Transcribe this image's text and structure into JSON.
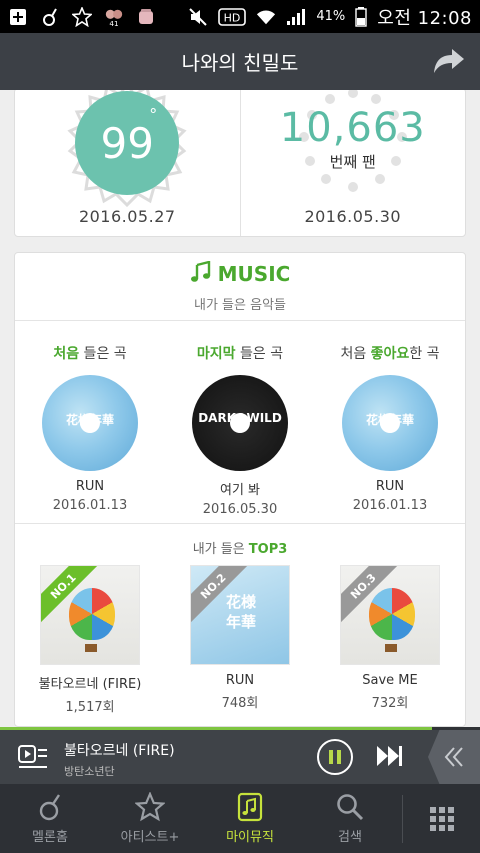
{
  "status_bar": {
    "battery": "41%",
    "time": "오전 12:08",
    "notification_count": "41"
  },
  "header": {
    "title": "나와의 친밀도",
    "share_icon": "share-arrow-icon"
  },
  "intimacy": {
    "temperature": {
      "value": "99",
      "unit": "°",
      "date": "2016.05.27"
    },
    "fan_rank": {
      "value": "10,663",
      "label": "번째 팬",
      "date": "2016.05.30"
    }
  },
  "music": {
    "title": "MUSIC",
    "subtitle": "내가 들은 음악들",
    "firsts": [
      {
        "label_highlight": "처음",
        "label_rest": " 들은 곡",
        "song": "RUN",
        "date": "2016.01.13",
        "cover": "blue",
        "cover_text": "花様年華"
      },
      {
        "label_highlight": "마지막",
        "label_rest": " 들은 곡",
        "song": "여기 봐",
        "date": "2016.05.30",
        "cover": "black",
        "cover_text": "DARK&WILD"
      },
      {
        "label_prefix": "처음 ",
        "label_highlight": "좋아요",
        "label_rest": "한 곡",
        "song": "RUN",
        "date": "2016.01.13",
        "cover": "blue",
        "cover_text": "花様年華"
      }
    ],
    "top3": {
      "title_prefix": "내가 들은 ",
      "title_highlight": "TOP3",
      "items": [
        {
          "rank": "NO.1",
          "name": "불타오르네 (FIRE)",
          "count": "1,517회",
          "ribbon": "green",
          "art": "balloon"
        },
        {
          "rank": "NO.2",
          "name": "RUN",
          "count": "748회",
          "ribbon": "grey",
          "art": "kanji",
          "kanji": "花様年華"
        },
        {
          "rank": "NO.3",
          "name": "Save ME",
          "count": "732회",
          "ribbon": "grey",
          "art": "balloon"
        }
      ]
    }
  },
  "player": {
    "track": "불타오르네 (FIRE)",
    "artist": "방탄소년단",
    "progress": 0.9
  },
  "bottom_nav": [
    {
      "label": "멜론홈",
      "icon": "melon-home-icon",
      "active": false
    },
    {
      "label": "아티스트+",
      "icon": "star-icon",
      "active": false
    },
    {
      "label": "마이뮤직",
      "icon": "my-music-icon",
      "active": true
    },
    {
      "label": "검색",
      "icon": "search-icon",
      "active": false
    }
  ],
  "colors": {
    "accent_green": "#4aa82e",
    "teal": "#6cc2ae",
    "header_bg": "#3c4046",
    "nav_active": "#c6e23c"
  }
}
